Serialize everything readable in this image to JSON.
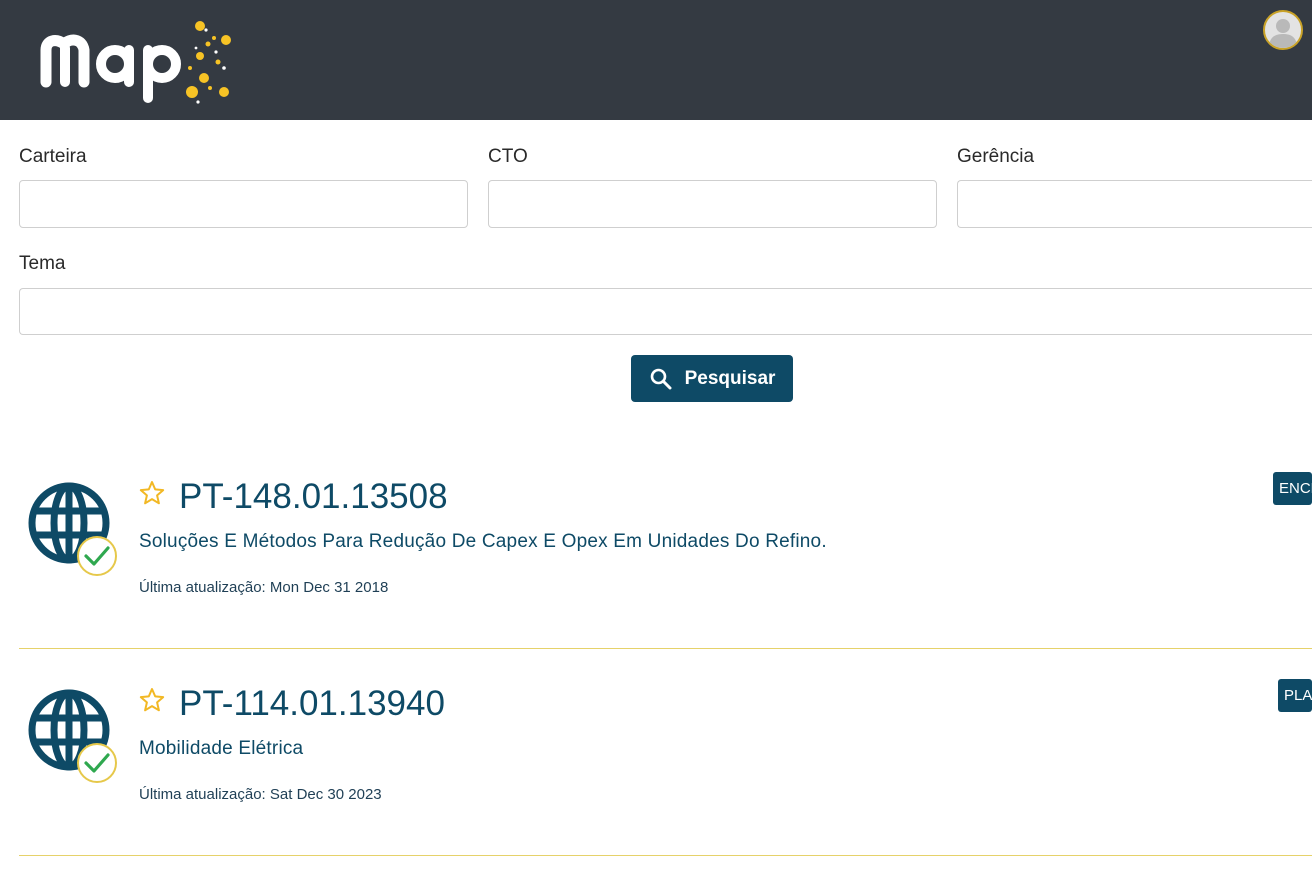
{
  "header": {
    "logo_text": "map",
    "brand_colors": {
      "background": "#343a42",
      "dots": "#f7c325",
      "accent": "#0e4a66"
    },
    "avatar_icon": "user-avatar-icon"
  },
  "filters": {
    "carteira": {
      "label": "Carteira",
      "value": "",
      "placeholder": ""
    },
    "cto": {
      "label": "CTO",
      "value": "",
      "placeholder": ""
    },
    "gerencia": {
      "label": "Gerência",
      "value": "",
      "placeholder": ""
    },
    "tema": {
      "label": "Tema",
      "value": "",
      "placeholder": ""
    }
  },
  "search": {
    "label": "Pesquisar",
    "icon": "search-icon"
  },
  "projects": [
    {
      "code": "PT-148.01.13508",
      "title": "Soluções E Métodos Para Redução De Capex E Opex Em Unidades Do Refino.",
      "updated": "Última atualização: Mon Dec 31 2018",
      "status": "ENCE",
      "icon": "globe-icon",
      "favorite_icon": "star-outline-icon",
      "status_icon": "check-icon"
    },
    {
      "code": "PT-114.01.13940",
      "title": "Mobilidade Elétrica",
      "updated": "Última atualização: Sat Dec 30 2023",
      "status": "PLA",
      "icon": "globe-icon",
      "favorite_icon": "star-outline-icon",
      "status_icon": "check-icon"
    }
  ]
}
